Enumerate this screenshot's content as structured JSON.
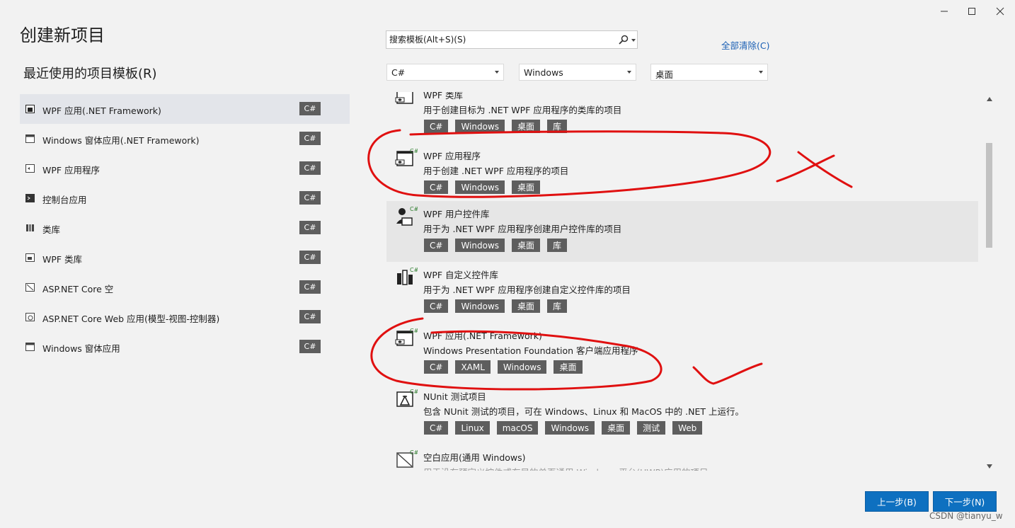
{
  "window": {
    "title": "创建新项目",
    "controls": [
      "minimize-icon",
      "maximize-icon",
      "close-icon"
    ]
  },
  "recent": {
    "heading": "最近使用的项目模板(R)",
    "items": [
      {
        "label": "WPF 应用(.NET Framework)",
        "tag": "C#",
        "icon": "wpf-app-icon",
        "selected": true
      },
      {
        "label": "Windows 窗体应用(.NET Framework)",
        "tag": "C#",
        "icon": "winforms-icon"
      },
      {
        "label": "WPF 应用程序",
        "tag": "C#",
        "icon": "wpf-app-icon"
      },
      {
        "label": "控制台应用",
        "tag": "C#",
        "icon": "console-icon"
      },
      {
        "label": "类库",
        "tag": "C#",
        "icon": "class-library-icon"
      },
      {
        "label": "WPF 类库",
        "tag": "C#",
        "icon": "wpf-library-icon"
      },
      {
        "label": "ASP.NET Core 空",
        "tag": "C#",
        "icon": "aspnet-empty-icon"
      },
      {
        "label": "ASP.NET Core Web 应用(模型-视图-控制器)",
        "tag": "C#",
        "icon": "aspnet-mvc-icon"
      },
      {
        "label": "Windows 窗体应用",
        "tag": "C#",
        "icon": "winforms-icon"
      }
    ]
  },
  "search": {
    "placeholder": "搜索模板(Alt+S)(S)",
    "icon": "search-icon"
  },
  "clear_all": "全部清除(C)",
  "filters": {
    "language": "C#",
    "platform": "Windows",
    "project_type": "桌面"
  },
  "templates": [
    {
      "name": "WPF 类库",
      "desc": "用于创建目标为 .NET WPF 应用程序的类库的项目",
      "tags": [
        "C#",
        "Windows",
        "桌面",
        "库"
      ],
      "icon": "wpf-library-icon"
    },
    {
      "name": "WPF 应用程序",
      "desc": "用于创建 .NET WPF 应用程序的项目",
      "tags": [
        "C#",
        "Windows",
        "桌面"
      ],
      "icon": "wpf-app-icon"
    },
    {
      "name": "WPF 用户控件库",
      "desc": "用于为 .NET WPF 应用程序创建用户控件库的项目",
      "tags": [
        "C#",
        "Windows",
        "桌面",
        "库"
      ],
      "icon": "wpf-user-control-icon",
      "hover": true
    },
    {
      "name": "WPF 自定义控件库",
      "desc": "用于为 .NET WPF 应用程序创建自定义控件库的项目",
      "tags": [
        "C#",
        "Windows",
        "桌面",
        "库"
      ],
      "icon": "wpf-custom-control-icon"
    },
    {
      "name": "WPF 应用(.NET Framework)",
      "desc": "Windows Presentation Foundation 客户端应用程序",
      "tags": [
        "C#",
        "XAML",
        "Windows",
        "桌面"
      ],
      "icon": "wpf-app-icon"
    },
    {
      "name": "NUnit 测试项目",
      "desc": "包含 NUnit 测试的项目，可在 Windows、Linux 和 MacOS 中的 .NET 上运行。",
      "tags": [
        "C#",
        "Linux",
        "macOS",
        "Windows",
        "桌面",
        "测试",
        "Web"
      ],
      "icon": "nunit-test-icon"
    },
    {
      "name": "空白应用(通用 Windows)",
      "desc": "用于没有预定义控件或布局的单页通用 Windows 平台(UWP)应用的项目",
      "tags": [],
      "icon": "uwp-blank-icon"
    }
  ],
  "buttons": {
    "back": "上一步(B)",
    "next": "下一步(N)"
  },
  "watermark": "CSDN @tianyu_w",
  "colors": {
    "accent": "#0e70c0",
    "tag_bg": "#5e5e5e",
    "annotation": "#e01010",
    "link": "#1a5fb4"
  }
}
